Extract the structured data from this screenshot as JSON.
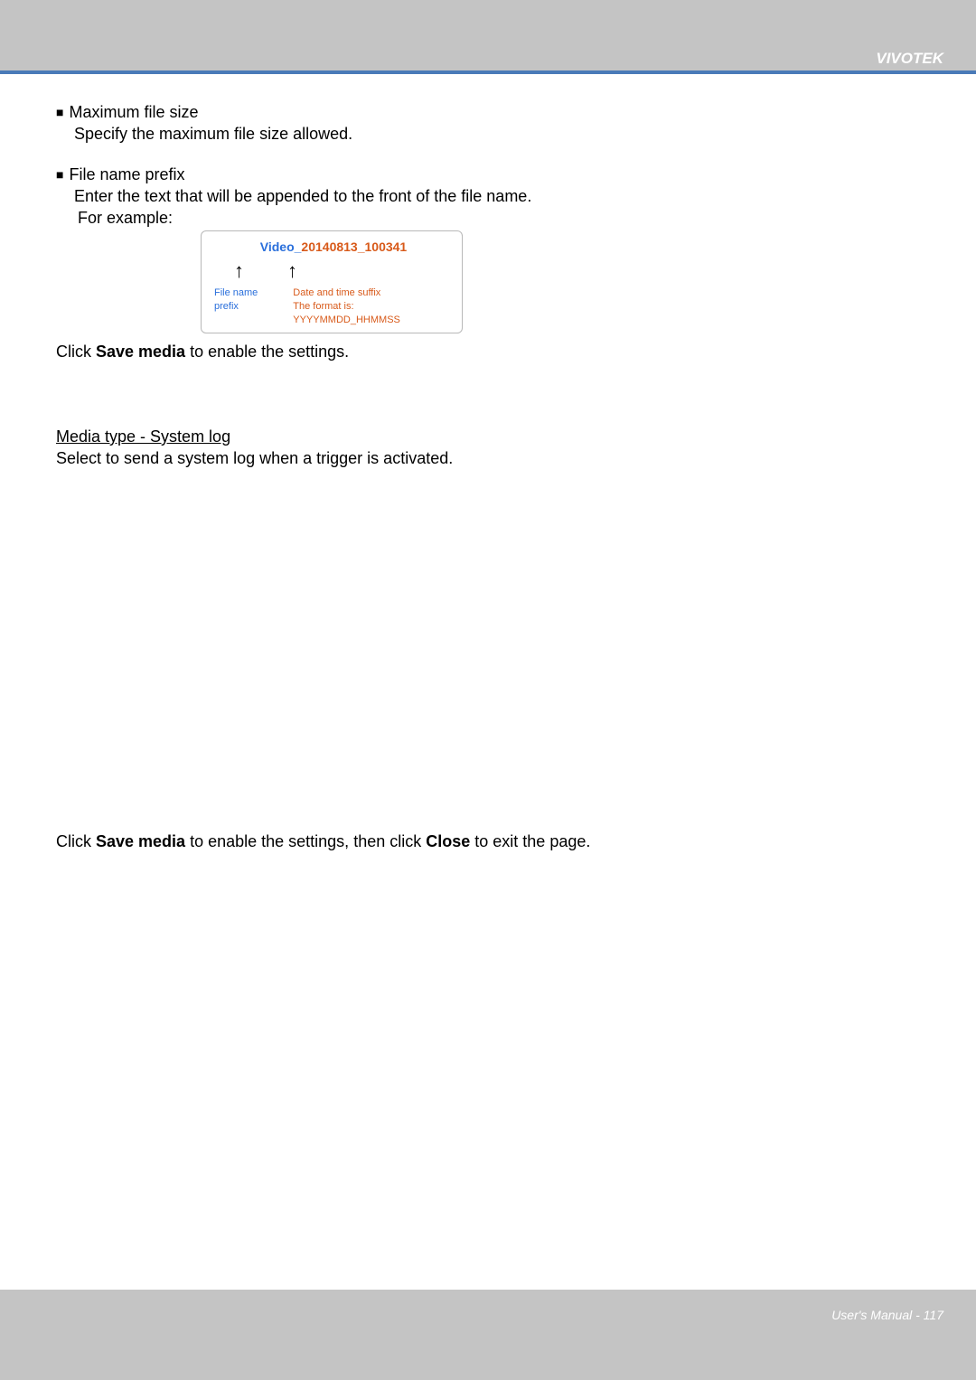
{
  "header": {
    "brand": "VIVOTEK"
  },
  "body": {
    "bullet1_title": "Maximum file size",
    "bullet1_desc": "Specify the maximum file size allowed.",
    "bullet2_title": "File name prefix",
    "bullet2_desc1": "Enter the text that will be appended to the front of the file name.",
    "bullet2_desc2": "For example:",
    "diagram": {
      "prefix": "Video_",
      "suffix": "20140813_100341",
      "label_prefix": "File name prefix",
      "label_suffix_line1": "Date and time suffix",
      "label_suffix_line2": "The format is: YYYYMMDD_HHMMSS"
    },
    "click1_pre": "Click ",
    "click1_bold": "Save media",
    "click1_post": " to enable the settings.",
    "media_heading": "Media type - System log",
    "media_desc": "Select to send a system log when a trigger is activated.",
    "click2_pre": "Click ",
    "click2_bold1": "Save media",
    "click2_mid": " to enable the settings, then click ",
    "click2_bold2": "Close",
    "click2_post": " to exit the page."
  },
  "footer": {
    "text": "User's Manual - 117"
  }
}
